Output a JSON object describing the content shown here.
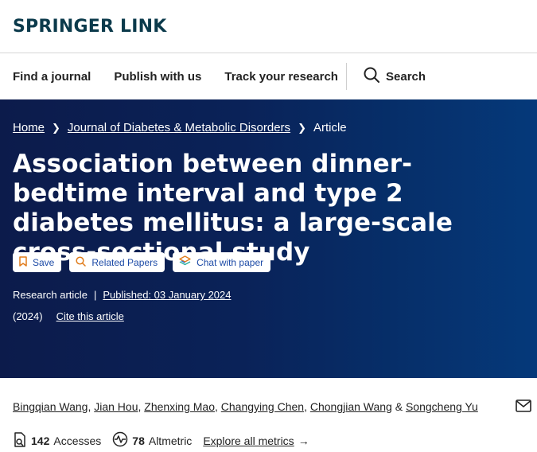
{
  "brand": {
    "logo": "SPRINGER LINK"
  },
  "nav": {
    "items": [
      "Find a journal",
      "Publish with us",
      "Track your research"
    ],
    "search_label": "Search"
  },
  "breadcrumb": {
    "home": "Home",
    "journal": "Journal of Diabetes & Metabolic Disorders",
    "current": "Article"
  },
  "article": {
    "title": "Association between dinner-bedtime interval and type 2 diabetes mellitus: a large-scale cross-sectional study",
    "actions": {
      "save": "Save",
      "related": "Related Papers",
      "chat": "Chat with paper"
    },
    "type": "Research article",
    "separator": "|",
    "published": "Published: 03 January 2024",
    "year": "(2024)",
    "cite": "Cite this article",
    "authors": [
      "Bingqian Wang",
      "Jian Hou",
      "Zhenxing Mao",
      "Changying Chen",
      "Chongjian Wang",
      "Songcheng Yu"
    ],
    "author_comma": ",",
    "author_amp": "&",
    "metrics": {
      "accesses_value": "142",
      "accesses_label": "Accesses",
      "altmetric_value": "78",
      "altmetric_label": "Altmetric",
      "explore": "Explore all metrics",
      "explore_arrow": "→"
    }
  },
  "colors": {
    "brand": "#0b3a4b",
    "hero_left": "#0c1b4b",
    "hero_right": "#05397a",
    "pill_text": "#1c4aa6",
    "pill_icon_orange": "#e07b1a"
  }
}
